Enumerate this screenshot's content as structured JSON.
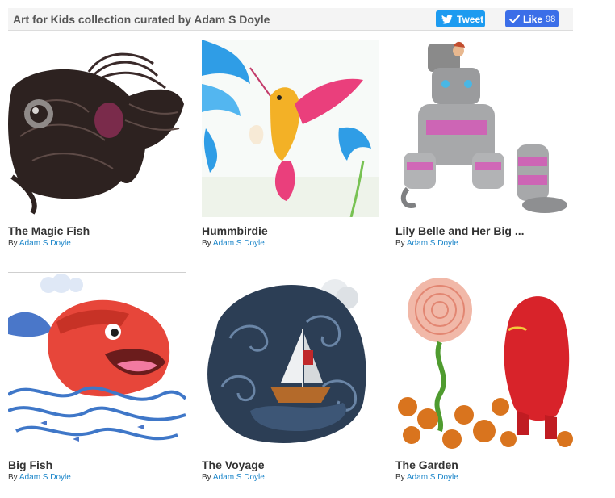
{
  "header": {
    "title": "Art for Kids collection curated by Adam S Doyle",
    "tweet_label": "Tweet",
    "like_label": "Like",
    "like_count": "98"
  },
  "colors": {
    "tweet_bg": "#1d9bf0",
    "like_bg": "#3b6ee8",
    "author_link": "#1a85c9"
  },
  "cards": [
    {
      "title": "The Magic Fish",
      "by_prefix": "By",
      "author": "Adam S Doyle",
      "image": "dark-fish-illustration"
    },
    {
      "title": "Hummbirdie",
      "by_prefix": "By",
      "author": "Adam S Doyle",
      "image": "hummingbird-illustration"
    },
    {
      "title": "Lily Belle and Her Big ...",
      "by_prefix": "By",
      "author": "Adam S Doyle",
      "image": "robot-illustration"
    },
    {
      "title": "Big Fish",
      "by_prefix": "By",
      "author": "Adam S Doyle",
      "image": "orange-fish-illustration"
    },
    {
      "title": "The Voyage",
      "by_prefix": "By",
      "author": "Adam S Doyle",
      "image": "boat-in-waves-illustration"
    },
    {
      "title": "The Garden",
      "by_prefix": "By",
      "author": "Adam S Doyle",
      "image": "red-creature-garden-illustration"
    }
  ]
}
